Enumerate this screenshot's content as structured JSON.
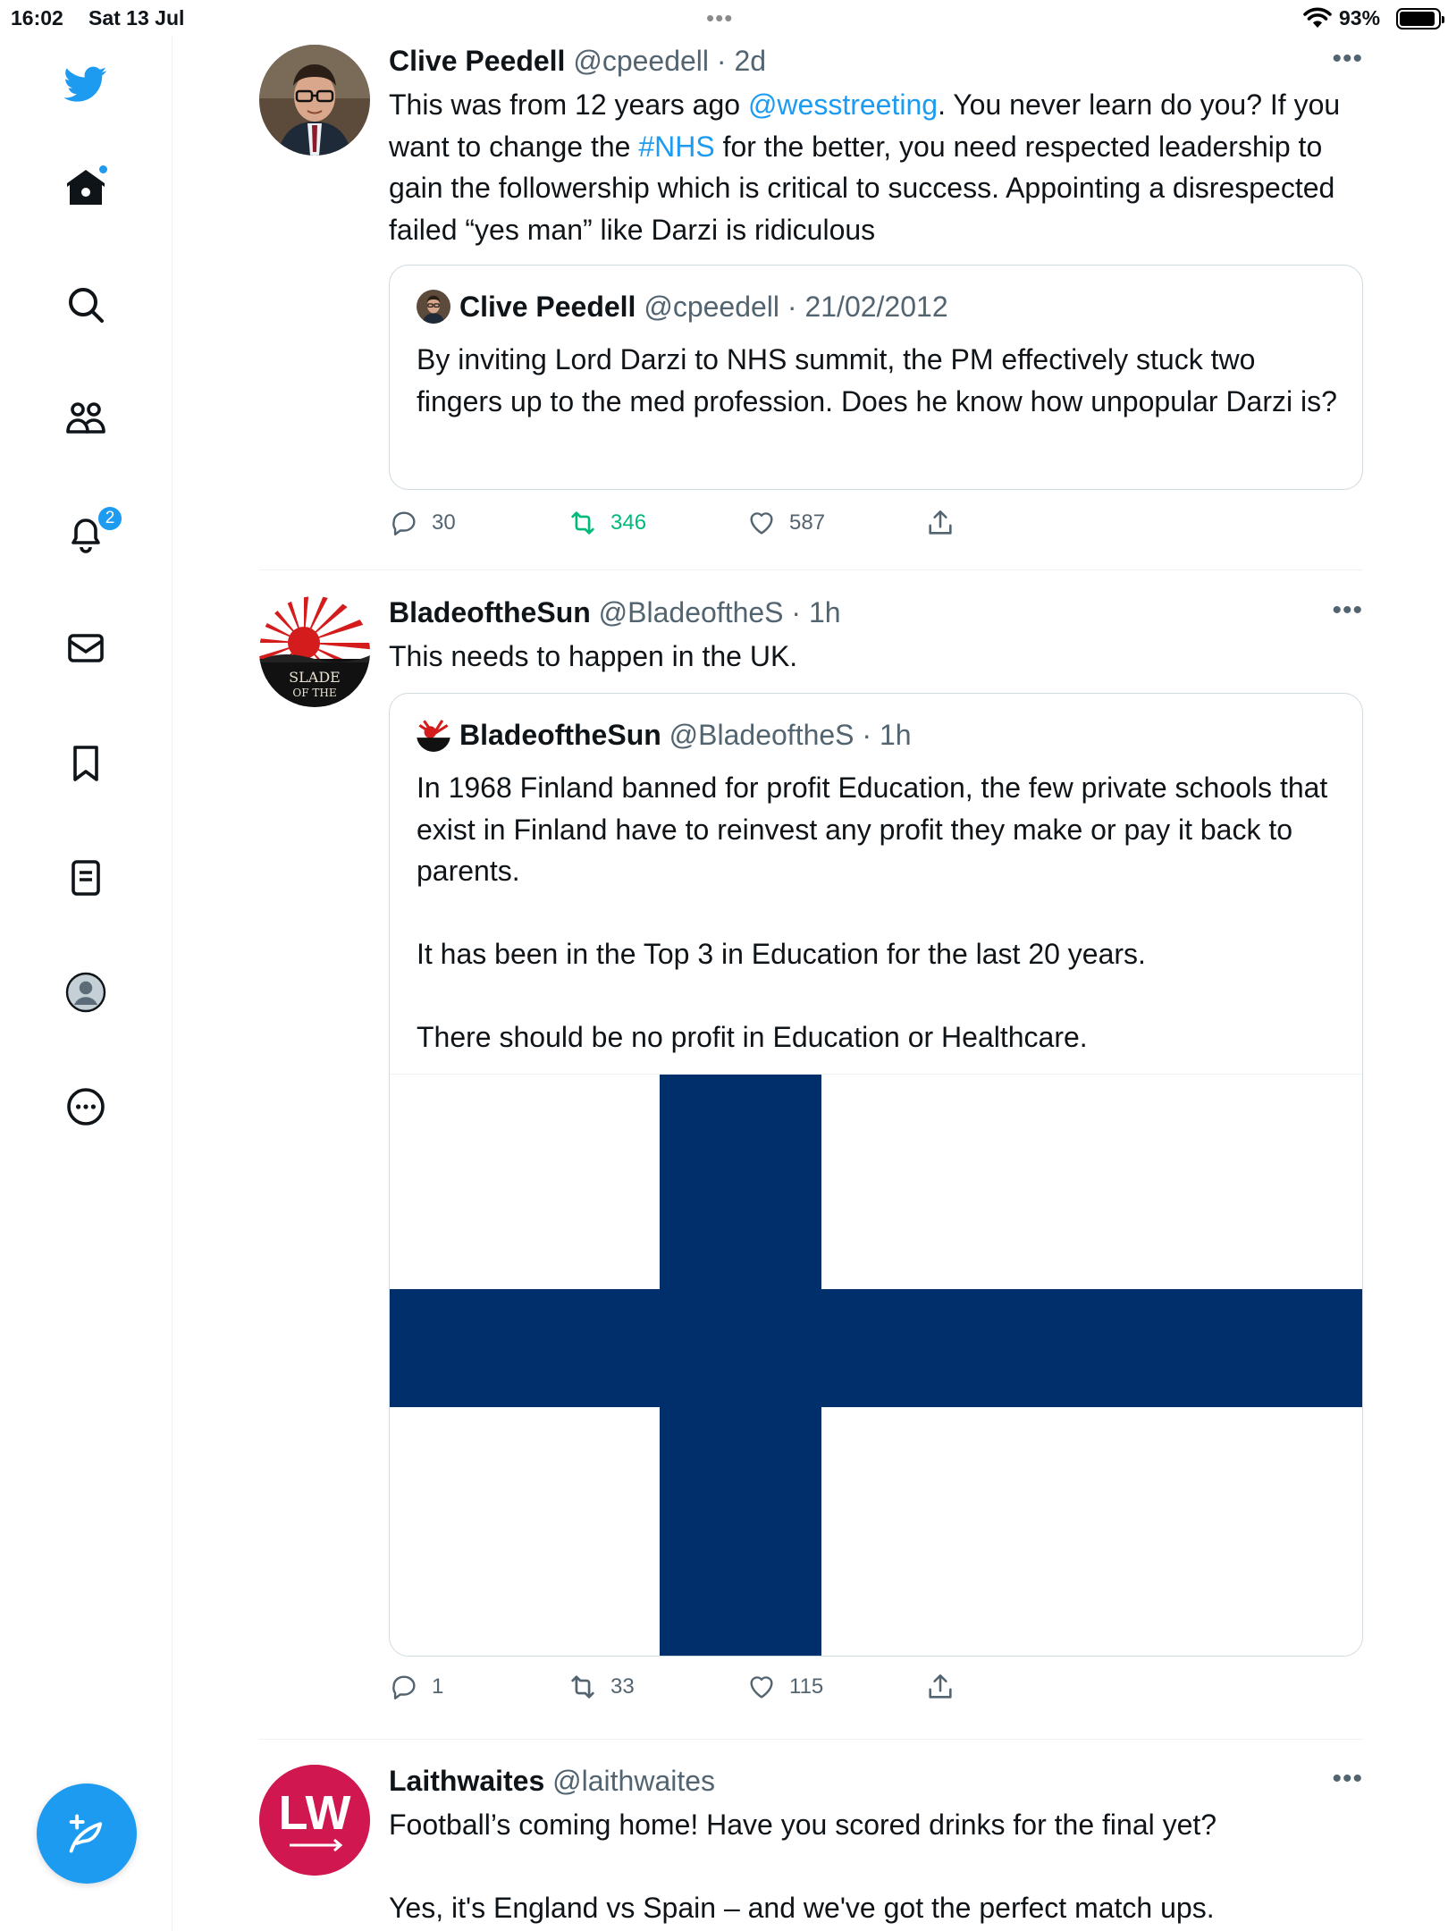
{
  "status_bar": {
    "time": "16:02",
    "date": "Sat 13 Jul",
    "battery": "93%",
    "battery_level": 0.93,
    "wifi_icon": "wifi-icon"
  },
  "sidebar": {
    "items": [
      {
        "icon": "twitter-logo-icon"
      },
      {
        "icon": "home-icon",
        "has_dot": true
      },
      {
        "icon": "search-icon"
      },
      {
        "icon": "communities-icon"
      },
      {
        "icon": "bell-icon",
        "badge": "2"
      },
      {
        "icon": "mail-icon"
      },
      {
        "icon": "bookmark-icon"
      },
      {
        "icon": "lists-icon"
      },
      {
        "icon": "profile-icon"
      },
      {
        "icon": "more-circle-icon"
      }
    ],
    "compose_icon": "compose-feather-icon"
  },
  "colors": {
    "accent": "#1d9bf0",
    "retweet_green": "#00ba7c",
    "text": "#0f1419",
    "secondary": "#536471",
    "finland_blue": "#002f6c"
  },
  "tweets": [
    {
      "name": "Clive Peedell",
      "handle": "@cpeedell",
      "time": "· 2d",
      "text_parts": [
        "This was from 12 years ago ",
        "@wesstreeting",
        ". You never learn do you? If you want to change the ",
        "#NHS",
        " for the better, you need respected leadership to gain the followership which is critical to success. Appointing a disrespected failed “yes man” like Darzi is ridiculous"
      ],
      "quote": {
        "name": "Clive Peedell",
        "handle": "@cpeedell",
        "time": "· 21/02/2012",
        "text": "By inviting Lord Darzi to NHS summit, the PM effectively stuck two fingers up to the med profession. Does he know how unpopular Darzi is?"
      },
      "replies": "30",
      "retweets": "346",
      "likes": "587"
    },
    {
      "name": "BladeoftheSun",
      "handle": "@BladeoftheS",
      "time": "· 1h",
      "text": "This needs to happen in the UK.",
      "quote": {
        "name": "BladeoftheSun",
        "handle": "@BladeoftheS",
        "time": "· 1h",
        "text": "In 1968 Finland banned for profit Education, the few private schools that exist in Finland have to reinvest any profit they make or pay it back to parents.\n\nIt has been in the Top 3 in Education for the last 20 years.\n\nThere should be no profit in Education or Healthcare."
      },
      "avatar_text": "BLADE OF THE SUN",
      "replies": "1",
      "retweets": "33",
      "likes": "115"
    },
    {
      "name": "Laithwaites",
      "handle": "@laithwaites",
      "time": "",
      "avatar_text": "LW",
      "text": "Football’s coming home! Have you scored drinks for the final yet?\n\nYes, it's England vs Spain – and we've got the perfect match ups."
    }
  ]
}
